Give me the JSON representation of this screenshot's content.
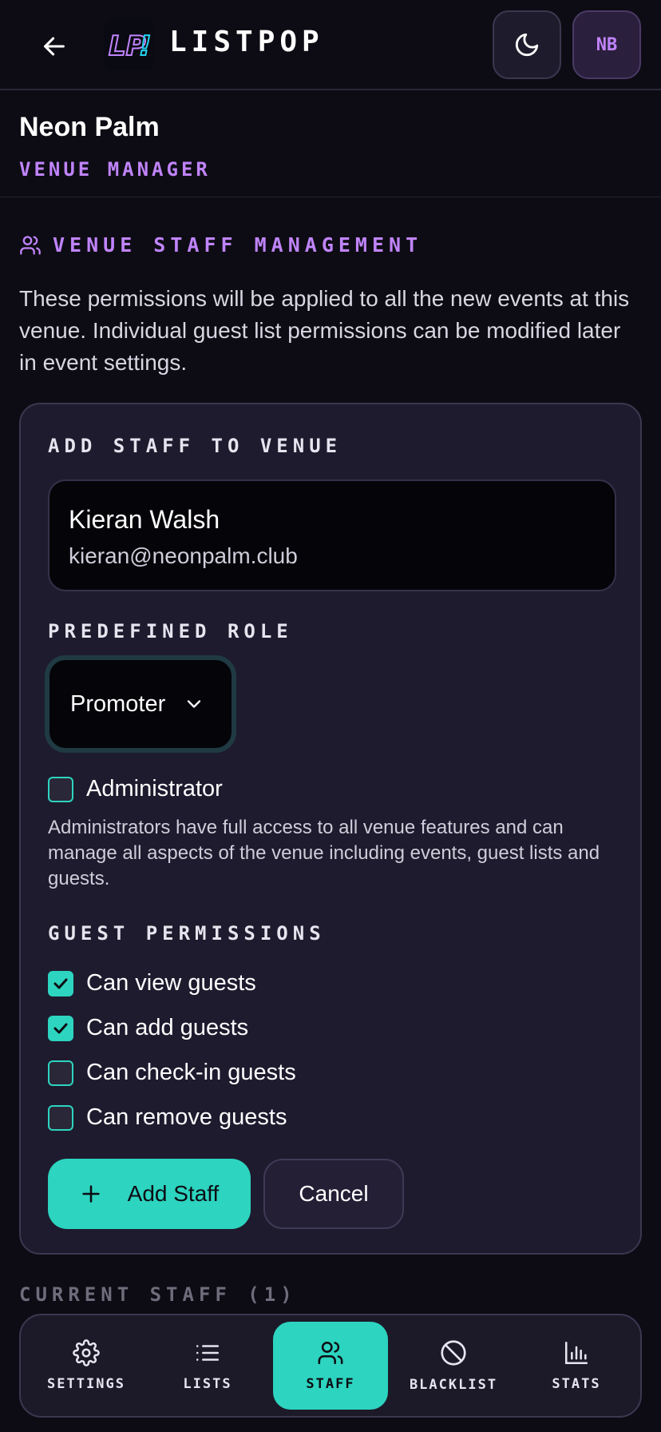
{
  "header": {
    "app_name": "LISTPOP",
    "logo_text": "LP!",
    "avatar_initials": "NB"
  },
  "venue": {
    "name": "Neon Palm",
    "role": "VENUE MANAGER"
  },
  "section": {
    "title": "VENUE STAFF MANAGEMENT",
    "description": "These permissions will be applied to all the new events at this venue. Individual guest list permissions can be modified later in event settings."
  },
  "add_staff": {
    "title": "ADD STAFF TO VENUE",
    "selected_user": {
      "name": "Kieran Walsh",
      "email": "kieran@neonpalm.club"
    },
    "role_label": "PREDEFINED ROLE",
    "role_value": "Promoter",
    "administrator": {
      "label": "Administrator",
      "checked": false,
      "description": "Administrators have full access to all venue features and can manage all aspects of the venue including events, guest lists and guests."
    },
    "guest_permissions_label": "GUEST PERMISSIONS",
    "permissions": [
      {
        "label": "Can view guests",
        "checked": true
      },
      {
        "label": "Can add guests",
        "checked": true
      },
      {
        "label": "Can check-in guests",
        "checked": false
      },
      {
        "label": "Can remove guests",
        "checked": false
      }
    ],
    "add_button": "Add Staff",
    "cancel_button": "Cancel"
  },
  "current_staff_label": "CURRENT STAFF (1)",
  "bottom_nav": [
    {
      "label": "SETTINGS",
      "icon": "gear-icon",
      "active": false
    },
    {
      "label": "LISTS",
      "icon": "list-icon",
      "active": false
    },
    {
      "label": "STAFF",
      "icon": "users-icon",
      "active": true
    },
    {
      "label": "BLACKLIST",
      "icon": "ban-icon",
      "active": false
    },
    {
      "label": "STATS",
      "icon": "bar-chart-icon",
      "active": false
    }
  ],
  "colors": {
    "accent_teal": "#2dd4bf",
    "accent_purple": "#c084fc",
    "background": "#0d0c14",
    "card": "#1e1b2e"
  }
}
